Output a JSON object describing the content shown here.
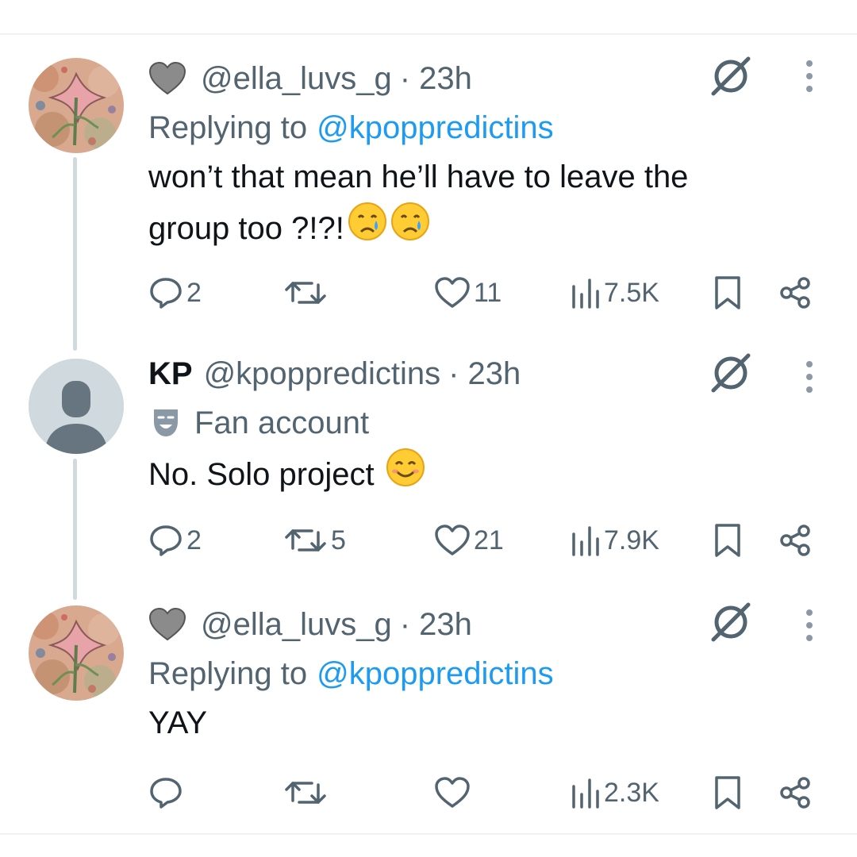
{
  "thread": {
    "tweets": [
      {
        "id": "t1",
        "avatar_type": "artwork",
        "name_prefix_emoji": "grey-heart",
        "display_name": "",
        "handle": "@ella_luvs_g",
        "time": "· 23h",
        "reply_label": "Replying to",
        "reply_handle": "@kpoppredictins",
        "text_line1": "won’t that mean he’ll have to leave the",
        "text_line2": "group too ?!?!",
        "text_emojis": [
          "crying-face",
          "crying-face"
        ],
        "stats": {
          "replies": "2",
          "retweets": "",
          "likes": "11",
          "views": "7.5K"
        }
      },
      {
        "id": "t2",
        "avatar_type": "default",
        "display_name": "KP",
        "handle": "@kpoppredictins",
        "time": "· 23h",
        "label_icon": "theater-mask-icon",
        "label_text": "Fan account",
        "text_line1": "No. Solo project",
        "text_emojis": [
          "smiling-face"
        ],
        "stats": {
          "replies": "2",
          "retweets": "5",
          "likes": "21",
          "views": "7.9K"
        }
      },
      {
        "id": "t3",
        "avatar_type": "artwork",
        "name_prefix_emoji": "grey-heart",
        "display_name": "",
        "handle": "@ella_luvs_g",
        "time": "· 23h",
        "reply_label": "Replying to",
        "reply_handle": "@kpoppredictins",
        "text_line1": "YAY",
        "stats": {
          "replies": "",
          "retweets": "",
          "likes": "",
          "views": "2.3K"
        }
      }
    ]
  },
  "colors": {
    "text_primary": "#0f1419",
    "text_secondary": "#536471",
    "link": "#1d9bf0",
    "thread_line": "#cfd9de",
    "divider": "#eff3f4"
  }
}
